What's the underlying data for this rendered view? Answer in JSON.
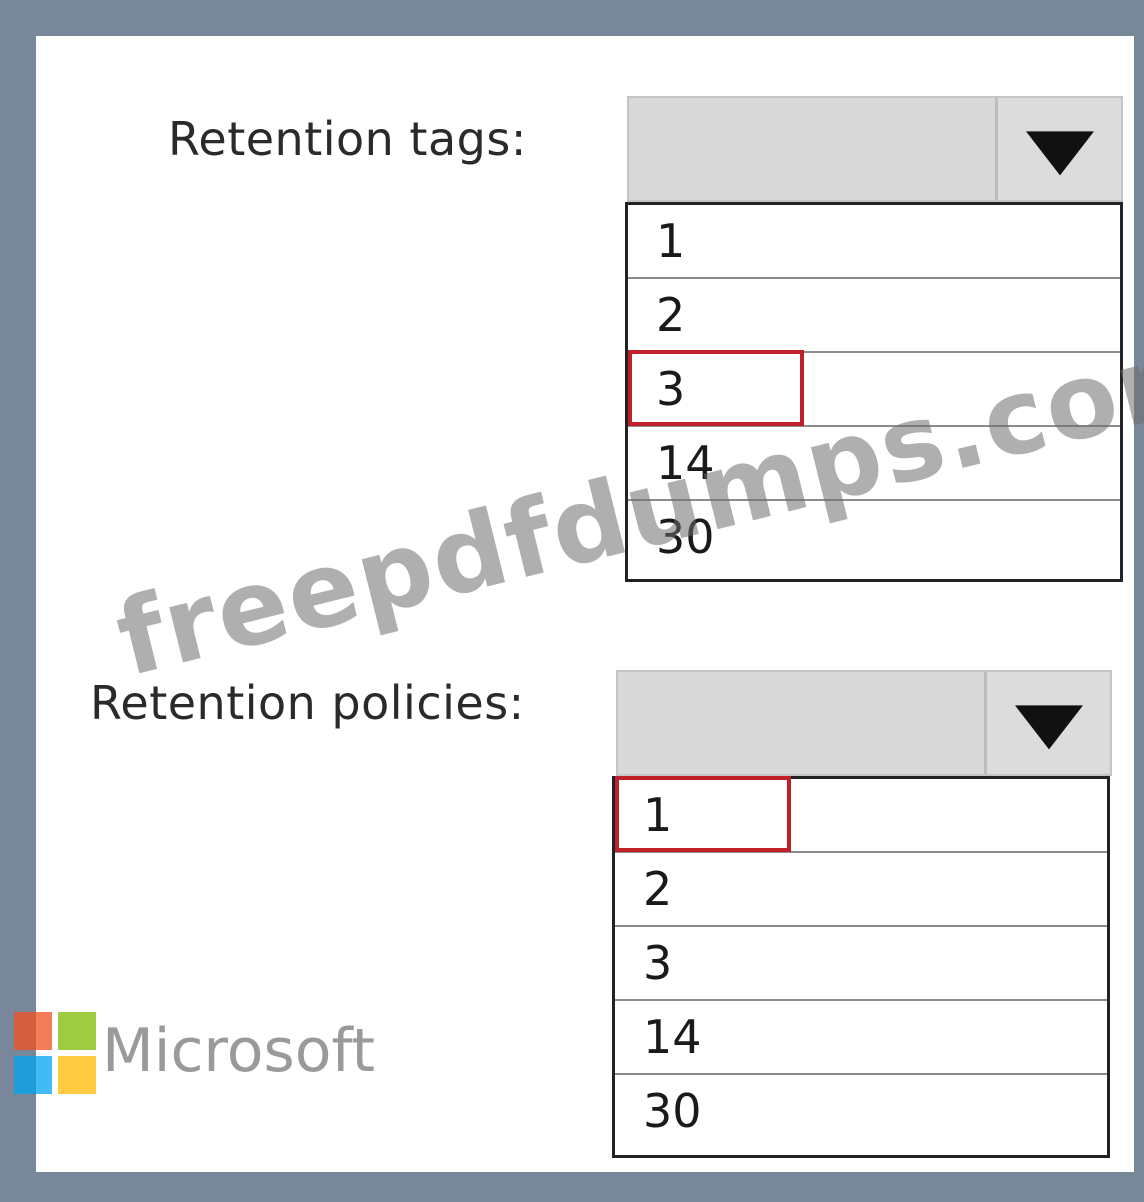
{
  "tags": {
    "label": "Retention tags:",
    "options": [
      "1",
      "2",
      "3",
      "14",
      "30"
    ],
    "highlighted": "3"
  },
  "policies": {
    "label": "Retention policies:",
    "options": [
      "1",
      "2",
      "3",
      "14",
      "30"
    ],
    "highlighted": "1"
  },
  "watermark": "freepdfdumps.com",
  "brand": {
    "name": "Microsoft",
    "colors": [
      "#f25022",
      "#7fba00",
      "#00a4ef",
      "#ffb900"
    ]
  },
  "colors": {
    "frame": "#78889a",
    "highlight_border": "#c0202a"
  },
  "icons": {
    "dropdown": "triangle-down-icon"
  }
}
